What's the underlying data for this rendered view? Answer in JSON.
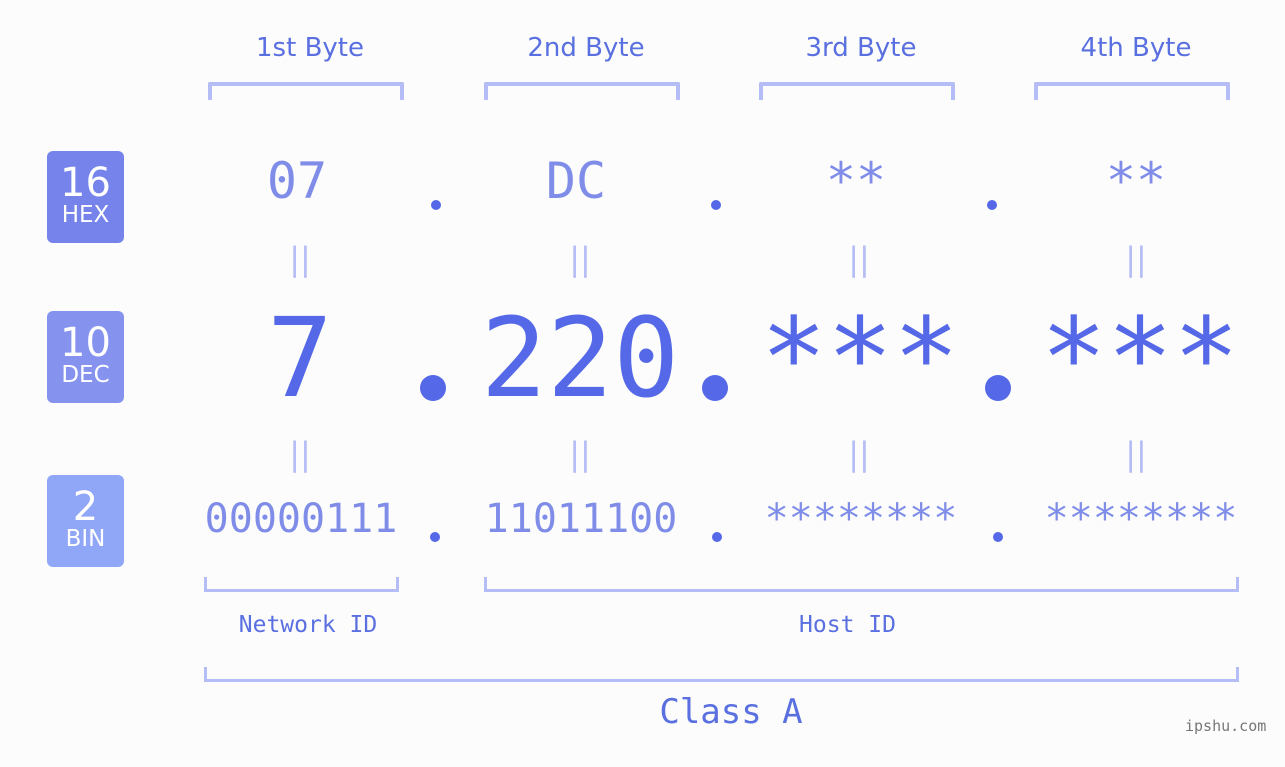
{
  "bytes": [
    {
      "label": "1st Byte",
      "hex": "07",
      "dec": "7",
      "bin": "00000111"
    },
    {
      "label": "2nd Byte",
      "hex": "DC",
      "dec": "220",
      "bin": "11011100"
    },
    {
      "label": "3rd Byte",
      "hex": "**",
      "dec": "***",
      "bin": "********"
    },
    {
      "label": "4th Byte",
      "hex": "**",
      "dec": "***",
      "bin": "********"
    }
  ],
  "bases": {
    "hex": {
      "number": "16",
      "label": "HEX",
      "color": "#7583ea"
    },
    "dec": {
      "number": "10",
      "label": "DEC",
      "color": "#8593ef"
    },
    "bin": {
      "number": "2",
      "label": "BIN",
      "color": "#90a6f7"
    }
  },
  "equals_symbol": "||",
  "network_id_label": "Network ID",
  "host_id_label": "Host ID",
  "class_label": "Class A",
  "watermark": "ipshu.com",
  "colors": {
    "accent": "#5468e8",
    "light_accent": "#7f8ce8",
    "bracket": "#b4bdf5",
    "background": "#fbfcfb"
  }
}
